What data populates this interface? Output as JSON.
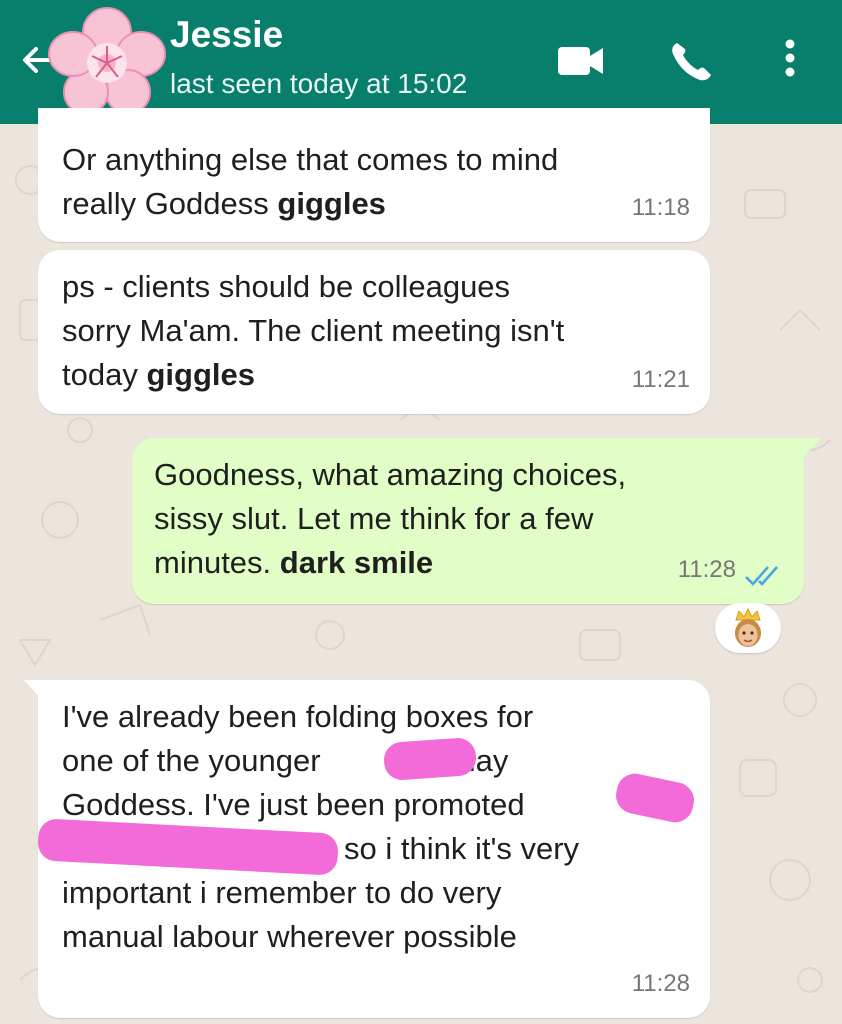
{
  "header": {
    "contact_name": "Jessie",
    "status": "last seen today at 15:02",
    "icons": [
      "back-arrow-icon",
      "flower-avatar",
      "video-call-icon",
      "phone-icon",
      "more-vert-icon"
    ]
  },
  "colors": {
    "header": "#087f6d",
    "incoming_bubble": "#ffffff",
    "outgoing_bubble": "#e1fec6",
    "chat_background": "#ece5dd",
    "read_ticks": "#4aa3e6",
    "redaction": "#f26bd8"
  },
  "messages": [
    {
      "direction": "in",
      "lines": [
        "Or anything else that comes to mind",
        "really Goddess"
      ],
      "bold": "giggles",
      "time": "11:18"
    },
    {
      "direction": "in",
      "lines": [
        "ps - clients should be colleagues",
        "sorry Ma'am. The client meeting isn't",
        "today"
      ],
      "bold": "giggles",
      "time": "11:21"
    },
    {
      "direction": "out",
      "lines": [
        "Goodness, what amazing choices,",
        "sissy slut. Let me think for a few",
        "minutes."
      ],
      "bold": "dark smile",
      "time": "11:28",
      "status_icon": "double-check-read-icon",
      "reaction": "queen-emoji-icon"
    },
    {
      "direction": "in",
      "lines": [
        "I've already been folding boxes for",
        "one of the younger",
        "today",
        "Goddess. I've just been promoted",
        "so i think it's very",
        "important i remember to do very",
        "manual labour wherever possible"
      ],
      "time": "11:28"
    }
  ]
}
